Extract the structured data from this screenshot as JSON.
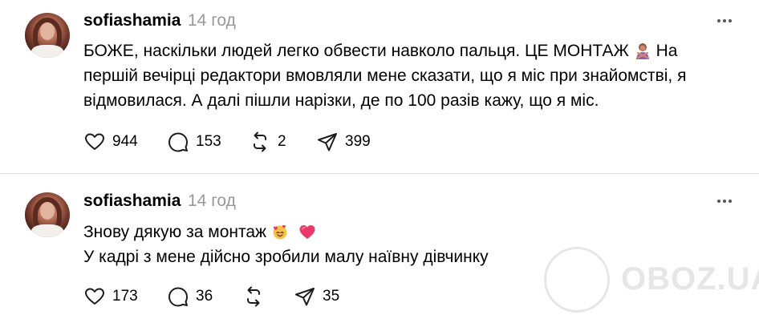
{
  "posts": [
    {
      "username": "sofiashamia",
      "time": "14 год",
      "lines": [
        [
          "БОЖЕ, наскільки людей легко обвести навколо пальця. ЦЕ МОНТАЖ ",
          "  На"
        ],
        "першій вечірці редактори вмовляли мене сказати, що я міс при знайомстві, я",
        "відмовилася. А далі пішли нарізки, де по 100 разів кажу, що я міс."
      ],
      "emoji": "person-gesturing-no-emoji",
      "likes": "944",
      "comments": "153",
      "reposts": "2",
      "shares": "399"
    },
    {
      "username": "sofiashamia",
      "time": "14 год",
      "line1": "Знову дякую за монтаж ",
      "line2": "У кадрі з мене дійсно зробили малу наївну дівчинку",
      "emoji1": "smiling-face-with-hearts-emoji",
      "emoji2": "heart-emoji",
      "likes": "173",
      "comments": "36",
      "reposts": "",
      "shares": "35"
    }
  ],
  "watermark": {
    "text": "OBOZ.UA"
  },
  "icons": {
    "like": "heart-icon",
    "comment": "comment-bubble-icon",
    "repost": "repost-icon",
    "share": "send-icon",
    "more": "more-dots-icon"
  },
  "colors": {
    "text": "#000000",
    "muted": "#999999",
    "divider": "#dbdbdb"
  }
}
